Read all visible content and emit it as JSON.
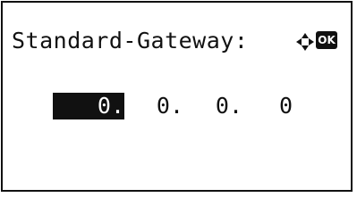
{
  "screen": {
    "title": "Standard-Gateway:",
    "nav_icon": "four-way-arrow-icon",
    "ok_label": "OK",
    "ip_octets": [
      "0.",
      "0.",
      "0.",
      "0"
    ],
    "selected_octet_index": 0,
    "colors": {
      "foreground": "#111111",
      "background": "#ffffff",
      "highlight": "#111111"
    }
  }
}
